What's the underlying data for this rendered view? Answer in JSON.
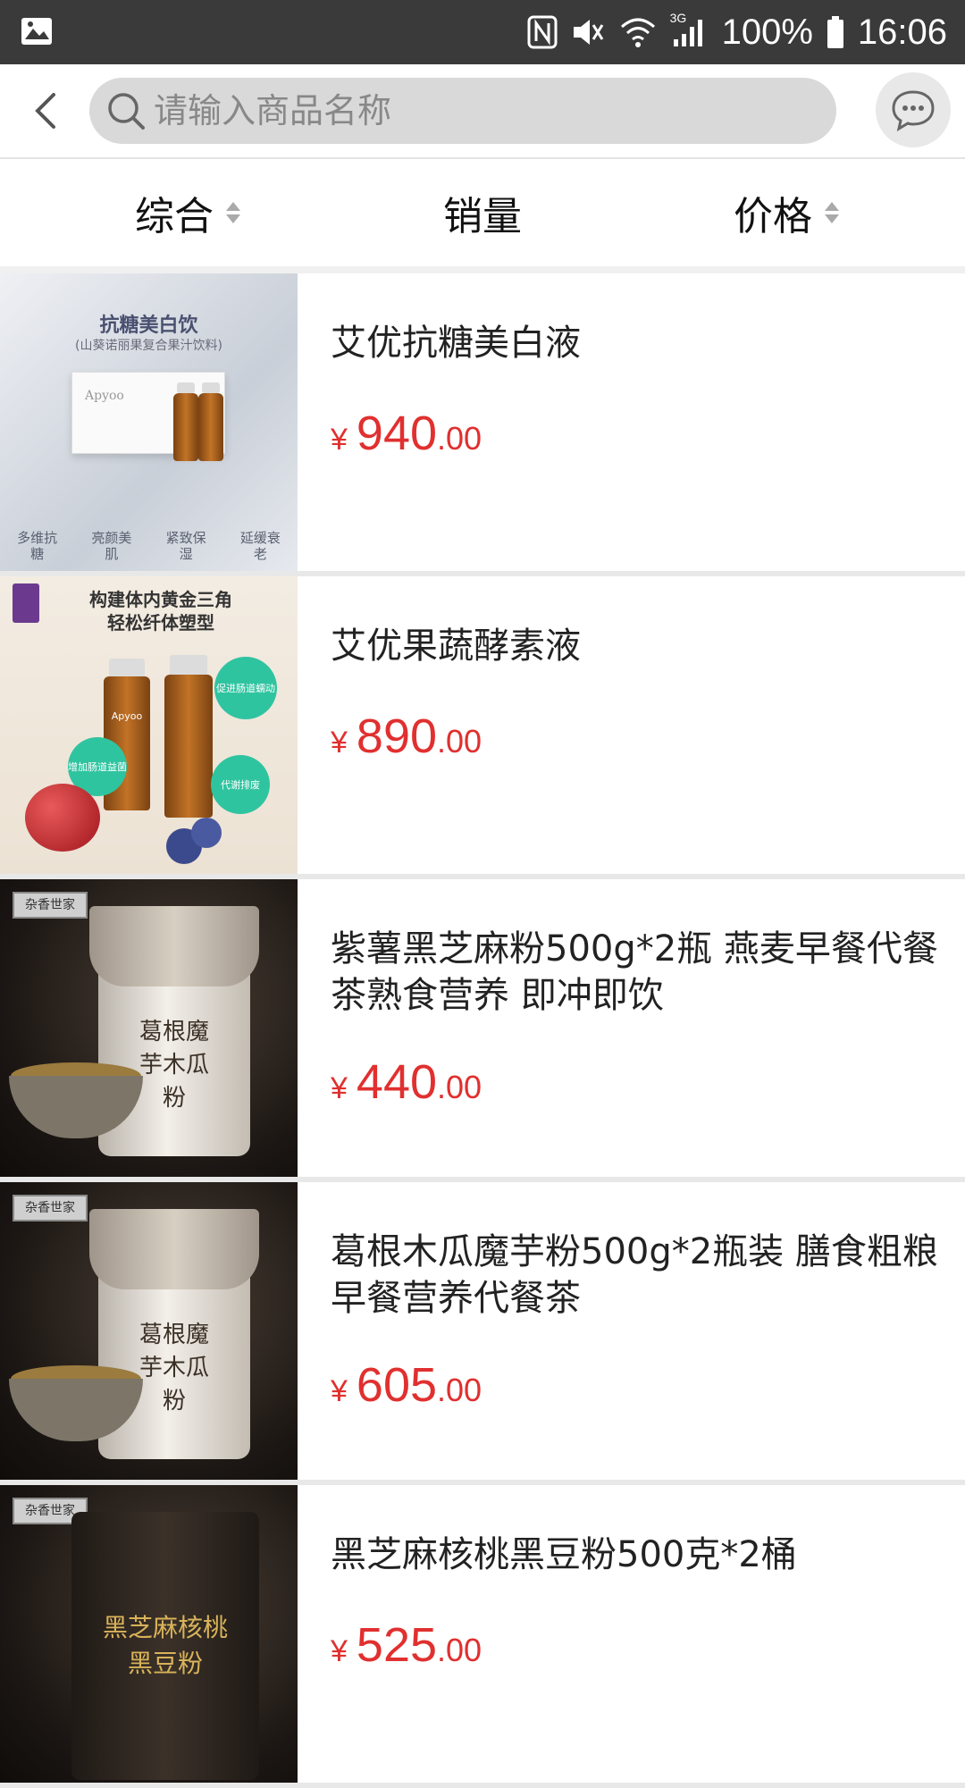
{
  "status_bar": {
    "battery": "100%",
    "time": "16:06",
    "network": "3G",
    "icons": [
      "image-icon",
      "nfc-icon",
      "mute-icon",
      "wifi-icon",
      "signal-icon",
      "battery-icon"
    ]
  },
  "header": {
    "search_placeholder": "请输入商品名称",
    "search_value": ""
  },
  "sort_tabs": [
    {
      "label": "综合",
      "has_arrows": true
    },
    {
      "label": "销量",
      "has_arrows": false
    },
    {
      "label": "价格",
      "has_arrows": true
    }
  ],
  "products": [
    {
      "title": "艾优抗糖美白液",
      "currency": "¥",
      "price_int": "940",
      "price_dec": ".00",
      "thumb": {
        "headline": "抗糖美白饮",
        "subline": "(山葵诺丽果复合果汁饮料)",
        "brand": "Apyoo",
        "features": [
          "多维抗糖",
          "亮颜美肌",
          "紧致保湿",
          "延缓衰老"
        ]
      }
    },
    {
      "title": "艾优果蔬酵素液",
      "currency": "¥",
      "price_int": "890",
      "price_dec": ".00",
      "thumb": {
        "headline_1": "构建体内黄金三角",
        "headline_2": "轻松纤体塑型",
        "brand": "Apyoo",
        "badges": [
          "促进肠道蠕动",
          "增加肠道益菌",
          "代谢排废"
        ]
      }
    },
    {
      "title": "紫薯黑芝麻粉500g*2瓶 燕麦早餐代餐茶熟食营养 即冲即饮",
      "currency": "¥",
      "price_int": "440",
      "price_dec": ".00",
      "thumb": {
        "logo": "杂香世家",
        "jar_text": "葛根魔芋木瓜粉"
      }
    },
    {
      "title": "葛根木瓜魔芋粉500g*2瓶装 膳食粗粮早餐营养代餐茶",
      "currency": "¥",
      "price_int": "605",
      "price_dec": ".00",
      "thumb": {
        "logo": "杂香世家",
        "jar_text": "葛根魔芋木瓜粉"
      }
    },
    {
      "title": "黑芝麻核桃黑豆粉500克*2桶",
      "currency": "¥",
      "price_int": "525",
      "price_dec": ".00",
      "thumb": {
        "logo": "杂香世家",
        "jar_text": "黑芝麻核桃黑豆粉"
      }
    }
  ],
  "colors": {
    "price": "#e0302f",
    "status_bar": "#3a3a3a",
    "search_bg": "#d9d9d9"
  }
}
